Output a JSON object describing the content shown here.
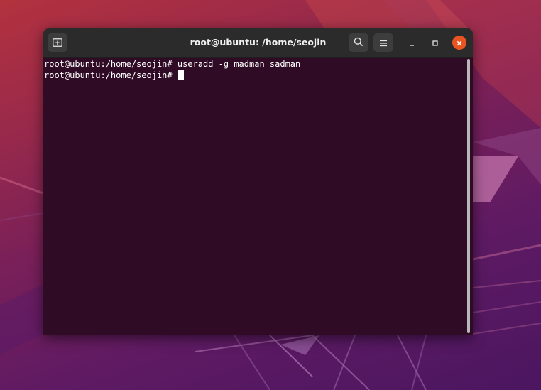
{
  "window": {
    "title": "root@ubuntu: /home/seojin"
  },
  "titlebar": {
    "new_tab_icon": "new-tab-icon",
    "search_icon": "search-icon",
    "menu_icon": "hamburger-menu-icon",
    "minimize_icon": "minimize-icon",
    "maximize_icon": "maximize-icon",
    "close_icon": "close-icon"
  },
  "terminal": {
    "lines": [
      {
        "prompt": "root@ubuntu:/home/seojin#",
        "command": " useradd -g madman sadman"
      },
      {
        "prompt": "root@ubuntu:/home/seojin#",
        "command": " "
      }
    ]
  },
  "colors": {
    "terminal_background": "#2f0b25",
    "titlebar_background": "#2b2b2b",
    "close_button": "#e95420",
    "text": "#ffffff"
  }
}
